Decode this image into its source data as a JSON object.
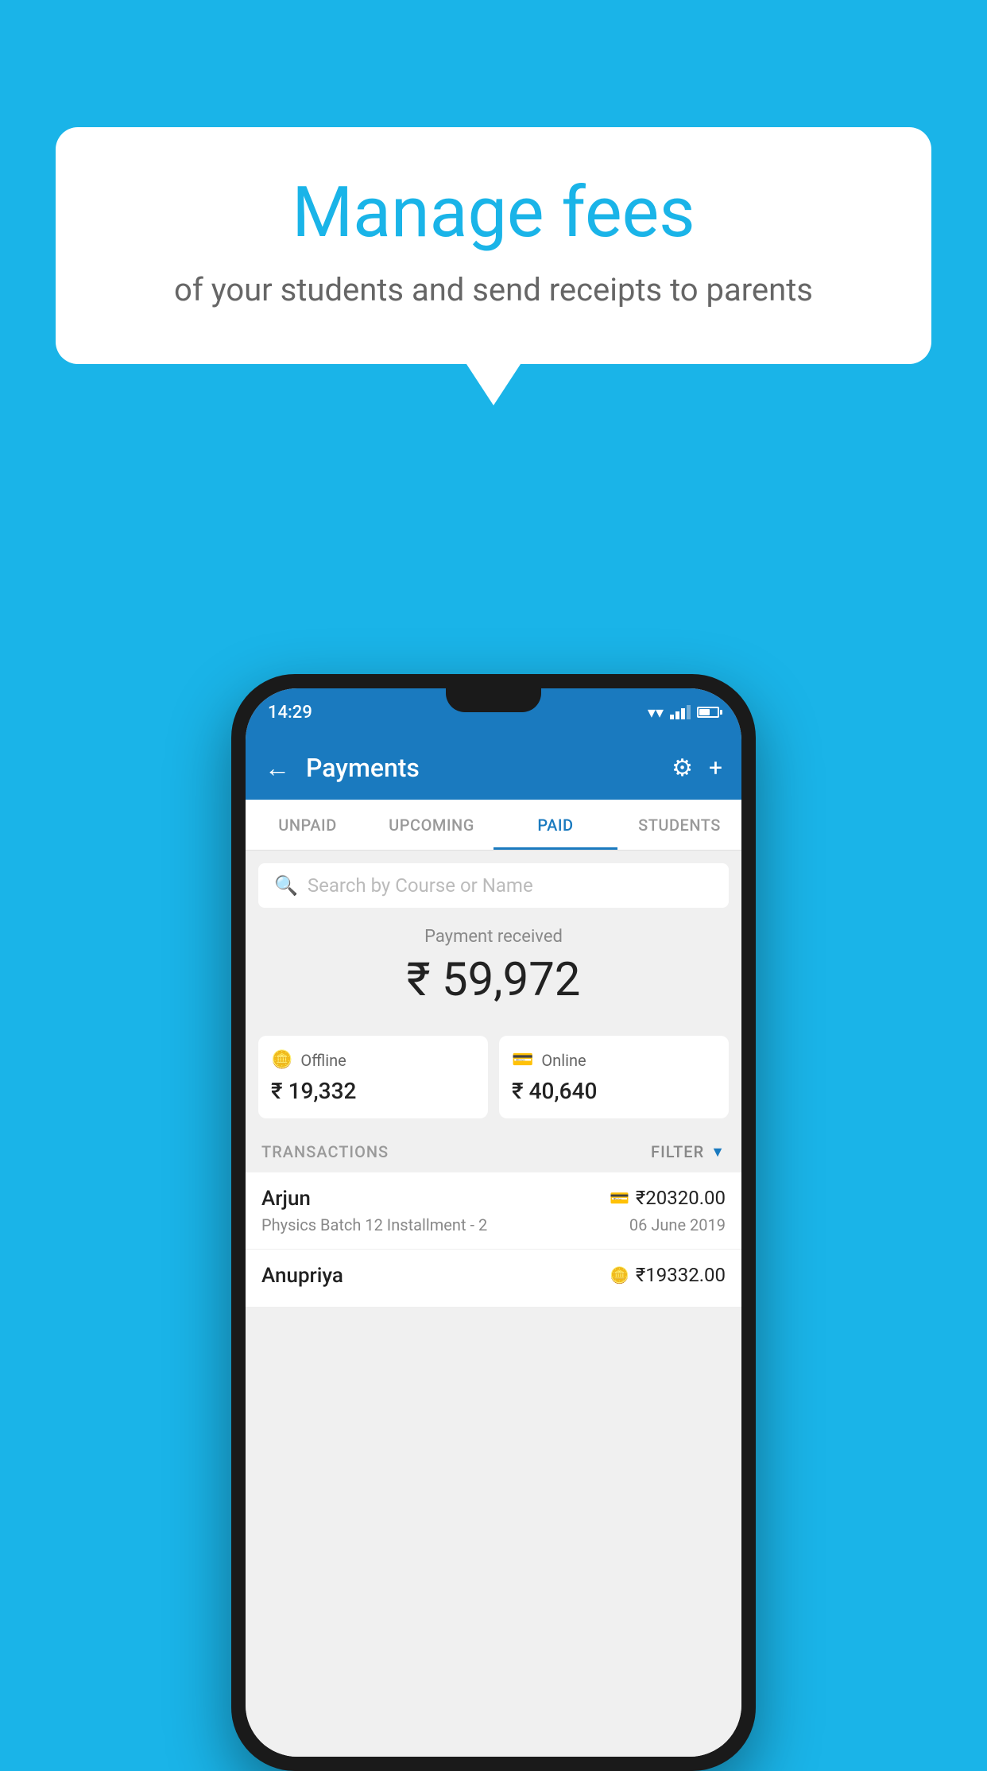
{
  "page": {
    "background_color": "#1ab4e8"
  },
  "speech_bubble": {
    "title": "Manage fees",
    "subtitle": "of your students and send receipts to parents"
  },
  "status_bar": {
    "time": "14:29",
    "wifi": "▼",
    "battery_percent": 60
  },
  "header": {
    "title": "Payments",
    "back_label": "←",
    "settings_label": "⚙",
    "add_label": "+"
  },
  "tabs": [
    {
      "label": "UNPAID",
      "active": false
    },
    {
      "label": "UPCOMING",
      "active": false
    },
    {
      "label": "PAID",
      "active": true
    },
    {
      "label": "STUDENTS",
      "active": false
    }
  ],
  "search": {
    "placeholder": "Search by Course or Name"
  },
  "payment_summary": {
    "label": "Payment received",
    "total": "₹ 59,972",
    "offline": {
      "label": "Offline",
      "amount": "₹ 19,332"
    },
    "online": {
      "label": "Online",
      "amount": "₹ 40,640"
    }
  },
  "transactions": {
    "section_label": "TRANSACTIONS",
    "filter_label": "FILTER",
    "rows": [
      {
        "name": "Arjun",
        "course": "Physics Batch 12 Installment - 2",
        "amount": "₹20320.00",
        "date": "06 June 2019",
        "mode": "online"
      },
      {
        "name": "Anupriya",
        "course": "",
        "amount": "₹19332.00",
        "date": "",
        "mode": "offline"
      }
    ]
  }
}
